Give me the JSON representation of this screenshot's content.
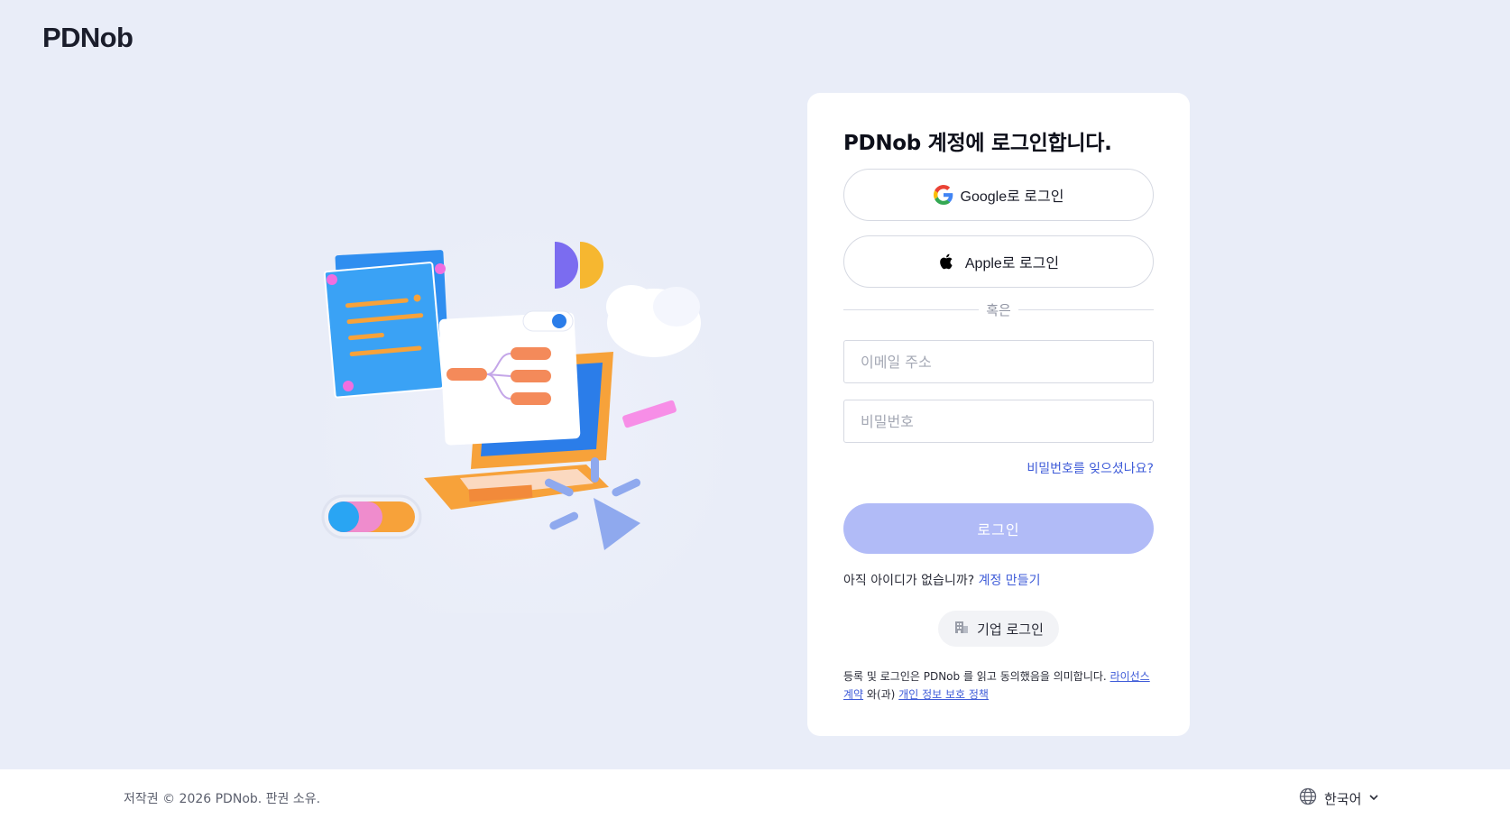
{
  "brand": {
    "logo": "PDNob"
  },
  "login": {
    "title": "PDNob 계정에 로그인합니다.",
    "google_label": "Google로 로그인",
    "apple_label": "Apple로 로그인",
    "divider": "혹은",
    "email_placeholder": "이메일 주소",
    "password_placeholder": "비밀번호",
    "forgot": "비밀번호를 잊으셨나요?",
    "submit": "로그인",
    "no_account": "아직 아이디가 없습니까?",
    "signup": "계정 만들기",
    "enterprise": "기업 로그인",
    "terms": {
      "prefix": "등록 및 로그인은 PDNob 를 읽고 동의했음을 의미합니다.",
      "license": "라이선스계약",
      "and": "와(과)",
      "privacy": "개인 정보 보호 정책"
    }
  },
  "footer": {
    "copyright": "저작권 © 2026 PDNob. 판권 소유.",
    "language": "한국어"
  },
  "colors": {
    "background": "#e9edf8",
    "accent": "#3e5bd8",
    "login_button": "#b1bbf7"
  },
  "icons": [
    "google-icon",
    "apple-icon",
    "building-icon",
    "globe-icon",
    "chevron-down-icon"
  ]
}
